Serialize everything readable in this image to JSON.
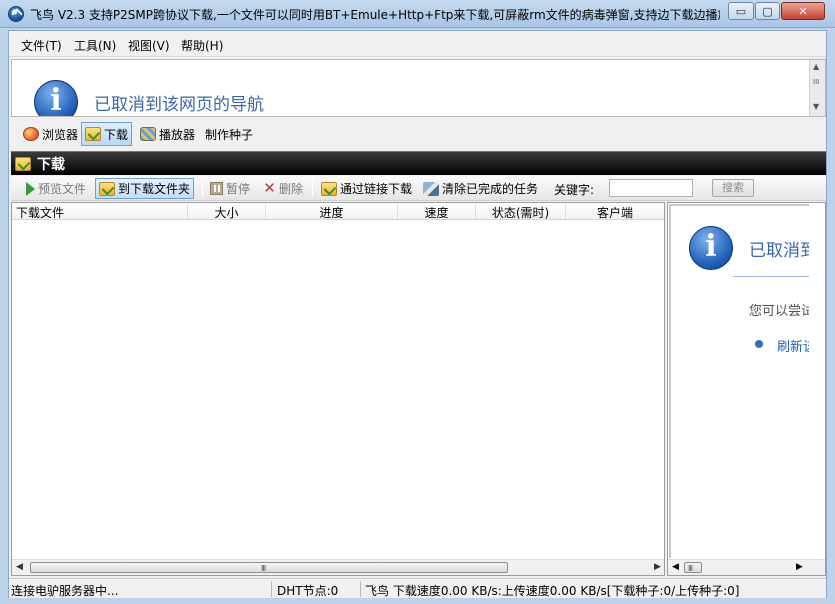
{
  "window": {
    "title": "飞鸟 V2.3 支持P2SMP跨协议下载,一个文件可以同时用BT+Emule+Http+Ftp来下载,可屏蔽rm文件的病毒弹窗,支持边下载边播放",
    "min_glyph": "▭",
    "max_glyph": "▢",
    "close_glyph": "✕"
  },
  "menu": {
    "file": "文件(T)",
    "tools": "工具(N)",
    "view": "视图(V)",
    "help": "帮助(H)"
  },
  "browser_panel": {
    "info_glyph": "i",
    "heading": "已取消到该网页的导航"
  },
  "modes": {
    "browser": "浏览器",
    "download": "下载",
    "player": "播放器",
    "make_seed": "制作种子"
  },
  "section": {
    "title": "下载"
  },
  "toolbar": {
    "preview": "预览文件",
    "open_folder": "到下载文件夹",
    "pause": "暂停",
    "delete": "删除",
    "by_link": "通过链接下载",
    "clear_done": "清除已完成的任务",
    "keyword_label": "关键字:",
    "keyword_value": "",
    "search": "搜索"
  },
  "columns": {
    "file": "下载文件",
    "size": "大小",
    "progress": "进度",
    "speed": "速度",
    "status": "状态(需时)",
    "client": "客户端"
  },
  "side_panel": {
    "info_glyph": "i",
    "heading": "已取消到该网页的导航",
    "text": "您可以尝试以下操作:",
    "link": "刷新该网页"
  },
  "statusbar": {
    "connection": "连接电驴服务器中...",
    "dht": "DHT节点:0",
    "speed": "飞鸟 下载速度0.00 KB/s:上传速度0.00 KB/s[下载种子:0/上传种子:0]"
  },
  "scroll": {
    "left": "◀",
    "right": "▶",
    "up": "▲",
    "down": "▼",
    "grip": "III"
  },
  "colors": {
    "accent": "#3b66a8",
    "header_bg": "#000000",
    "selected": "#c3dcf6"
  }
}
